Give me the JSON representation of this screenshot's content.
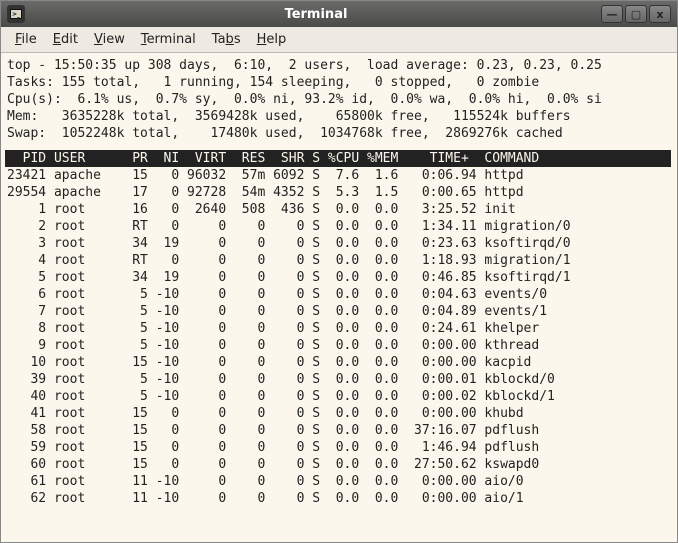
{
  "window": {
    "title": "Terminal",
    "buttons": {
      "min": "—",
      "max": "▢",
      "close": "x"
    }
  },
  "menubar": {
    "file": "File",
    "edit": "Edit",
    "view": "View",
    "terminal": "Terminal",
    "tabs": "Tabs",
    "help": "Help"
  },
  "top": {
    "line1": "top - 15:50:35 up 308 days,  6:10,  2 users,  load average: 0.23, 0.23, 0.25",
    "line2": "Tasks: 155 total,   1 running, 154 sleeping,   0 stopped,   0 zombie",
    "line3": "Cpu(s):  6.1% us,  0.7% sy,  0.0% ni, 93.2% id,  0.0% wa,  0.0% hi,  0.0% si",
    "line4": "Mem:   3635228k total,  3569428k used,    65800k free,   115524k buffers",
    "line5": "Swap:  1052248k total,    17480k used,  1034768k free,  2869276k cached"
  },
  "columns": {
    "header": "  PID USER      PR  NI  VIRT  RES  SHR S %CPU %MEM    TIME+  COMMAND"
  },
  "processes": [
    {
      "pid": "23421",
      "user": "apache",
      "pr": "15",
      "ni": "0",
      "virt": "96032",
      "res": "57m",
      "shr": "6092",
      "s": "S",
      "cpu": "7.6",
      "mem": "1.6",
      "time": "0:06.94",
      "cmd": "httpd"
    },
    {
      "pid": "29554",
      "user": "apache",
      "pr": "17",
      "ni": "0",
      "virt": "92728",
      "res": "54m",
      "shr": "4352",
      "s": "S",
      "cpu": "5.3",
      "mem": "1.5",
      "time": "0:00.65",
      "cmd": "httpd"
    },
    {
      "pid": "1",
      "user": "root",
      "pr": "16",
      "ni": "0",
      "virt": "2640",
      "res": "508",
      "shr": "436",
      "s": "S",
      "cpu": "0.0",
      "mem": "0.0",
      "time": "3:25.52",
      "cmd": "init"
    },
    {
      "pid": "2",
      "user": "root",
      "pr": "RT",
      "ni": "0",
      "virt": "0",
      "res": "0",
      "shr": "0",
      "s": "S",
      "cpu": "0.0",
      "mem": "0.0",
      "time": "1:34.11",
      "cmd": "migration/0"
    },
    {
      "pid": "3",
      "user": "root",
      "pr": "34",
      "ni": "19",
      "virt": "0",
      "res": "0",
      "shr": "0",
      "s": "S",
      "cpu": "0.0",
      "mem": "0.0",
      "time": "0:23.63",
      "cmd": "ksoftirqd/0"
    },
    {
      "pid": "4",
      "user": "root",
      "pr": "RT",
      "ni": "0",
      "virt": "0",
      "res": "0",
      "shr": "0",
      "s": "S",
      "cpu": "0.0",
      "mem": "0.0",
      "time": "1:18.93",
      "cmd": "migration/1"
    },
    {
      "pid": "5",
      "user": "root",
      "pr": "34",
      "ni": "19",
      "virt": "0",
      "res": "0",
      "shr": "0",
      "s": "S",
      "cpu": "0.0",
      "mem": "0.0",
      "time": "0:46.85",
      "cmd": "ksoftirqd/1"
    },
    {
      "pid": "6",
      "user": "root",
      "pr": "5",
      "ni": "-10",
      "virt": "0",
      "res": "0",
      "shr": "0",
      "s": "S",
      "cpu": "0.0",
      "mem": "0.0",
      "time": "0:04.63",
      "cmd": "events/0"
    },
    {
      "pid": "7",
      "user": "root",
      "pr": "5",
      "ni": "-10",
      "virt": "0",
      "res": "0",
      "shr": "0",
      "s": "S",
      "cpu": "0.0",
      "mem": "0.0",
      "time": "0:04.89",
      "cmd": "events/1"
    },
    {
      "pid": "8",
      "user": "root",
      "pr": "5",
      "ni": "-10",
      "virt": "0",
      "res": "0",
      "shr": "0",
      "s": "S",
      "cpu": "0.0",
      "mem": "0.0",
      "time": "0:24.61",
      "cmd": "khelper"
    },
    {
      "pid": "9",
      "user": "root",
      "pr": "5",
      "ni": "-10",
      "virt": "0",
      "res": "0",
      "shr": "0",
      "s": "S",
      "cpu": "0.0",
      "mem": "0.0",
      "time": "0:00.00",
      "cmd": "kthread"
    },
    {
      "pid": "10",
      "user": "root",
      "pr": "15",
      "ni": "-10",
      "virt": "0",
      "res": "0",
      "shr": "0",
      "s": "S",
      "cpu": "0.0",
      "mem": "0.0",
      "time": "0:00.00",
      "cmd": "kacpid"
    },
    {
      "pid": "39",
      "user": "root",
      "pr": "5",
      "ni": "-10",
      "virt": "0",
      "res": "0",
      "shr": "0",
      "s": "S",
      "cpu": "0.0",
      "mem": "0.0",
      "time": "0:00.01",
      "cmd": "kblockd/0"
    },
    {
      "pid": "40",
      "user": "root",
      "pr": "5",
      "ni": "-10",
      "virt": "0",
      "res": "0",
      "shr": "0",
      "s": "S",
      "cpu": "0.0",
      "mem": "0.0",
      "time": "0:00.02",
      "cmd": "kblockd/1"
    },
    {
      "pid": "41",
      "user": "root",
      "pr": "15",
      "ni": "0",
      "virt": "0",
      "res": "0",
      "shr": "0",
      "s": "S",
      "cpu": "0.0",
      "mem": "0.0",
      "time": "0:00.00",
      "cmd": "khubd"
    },
    {
      "pid": "58",
      "user": "root",
      "pr": "15",
      "ni": "0",
      "virt": "0",
      "res": "0",
      "shr": "0",
      "s": "S",
      "cpu": "0.0",
      "mem": "0.0",
      "time": "37:16.07",
      "cmd": "pdflush"
    },
    {
      "pid": "59",
      "user": "root",
      "pr": "15",
      "ni": "0",
      "virt": "0",
      "res": "0",
      "shr": "0",
      "s": "S",
      "cpu": "0.0",
      "mem": "0.0",
      "time": "1:46.94",
      "cmd": "pdflush"
    },
    {
      "pid": "60",
      "user": "root",
      "pr": "15",
      "ni": "0",
      "virt": "0",
      "res": "0",
      "shr": "0",
      "s": "S",
      "cpu": "0.0",
      "mem": "0.0",
      "time": "27:50.62",
      "cmd": "kswapd0"
    },
    {
      "pid": "61",
      "user": "root",
      "pr": "11",
      "ni": "-10",
      "virt": "0",
      "res": "0",
      "shr": "0",
      "s": "S",
      "cpu": "0.0",
      "mem": "0.0",
      "time": "0:00.00",
      "cmd": "aio/0"
    },
    {
      "pid": "62",
      "user": "root",
      "pr": "11",
      "ni": "-10",
      "virt": "0",
      "res": "0",
      "shr": "0",
      "s": "S",
      "cpu": "0.0",
      "mem": "0.0",
      "time": "0:00.00",
      "cmd": "aio/1"
    }
  ]
}
